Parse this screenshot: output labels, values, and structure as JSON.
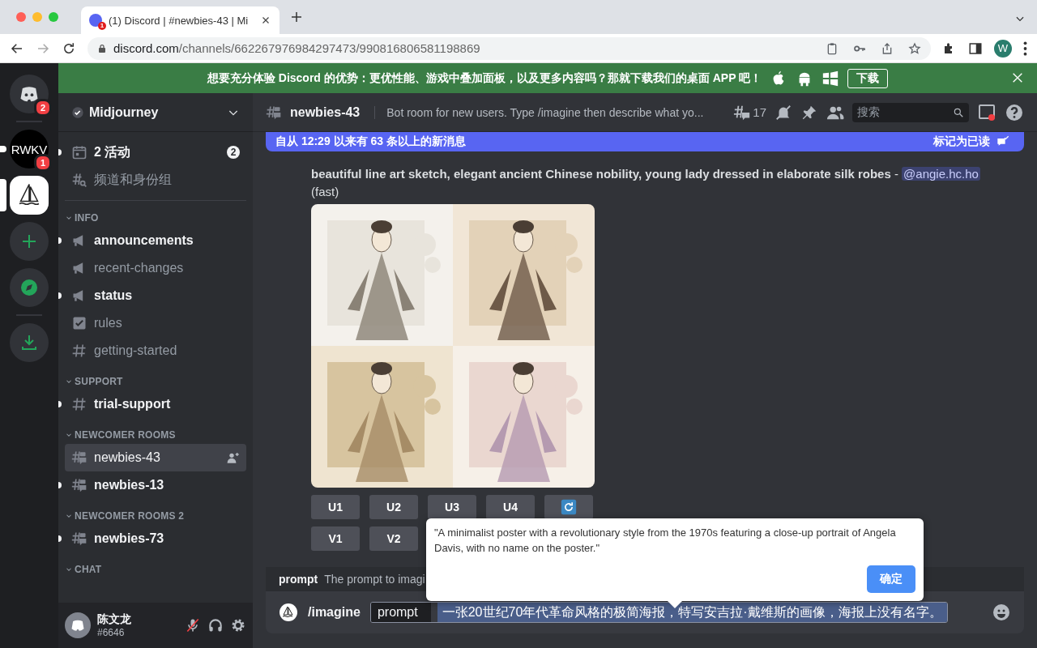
{
  "browser": {
    "tab_title": "(1) Discord | #newbies-43 | Mi",
    "tab_badge": "1",
    "url_domain": "discord.com",
    "url_path": "/channels/662267976984297473/990816806581198869",
    "profile": "W"
  },
  "banner": {
    "text": "想要充分体验 Discord 的优势：更优性能、游戏中叠加面板，以及更多内容吗？那就下载我们的桌面 APP 吧！",
    "button": "下载"
  },
  "servers": [
    {
      "kind": "home",
      "badge": "2",
      "selected": false
    },
    {
      "kind": "text",
      "label": "RWKV",
      "badge": "1",
      "selected": false,
      "unread": true
    },
    {
      "kind": "boat",
      "selected": true
    },
    {
      "kind": "add"
    },
    {
      "kind": "explore"
    },
    {
      "kind": "download"
    }
  ],
  "server_name": "Midjourney",
  "top_items": [
    {
      "kind": "events",
      "label": "2 活动",
      "badge": "2"
    },
    {
      "kind": "browse",
      "label": "频道和身份组"
    }
  ],
  "categories": [
    {
      "name": "INFO",
      "channels": [
        {
          "kind": "announcement",
          "name": "announcements",
          "unread": true,
          "selected": false
        },
        {
          "kind": "announcement",
          "name": "recent-changes",
          "unread": false,
          "selected": false
        },
        {
          "kind": "announcement",
          "name": "status",
          "unread": true,
          "selected": false
        },
        {
          "kind": "rules",
          "name": "rules",
          "unread": false,
          "selected": false
        },
        {
          "kind": "text",
          "name": "getting-started",
          "unread": false,
          "selected": false
        }
      ]
    },
    {
      "name": "SUPPORT",
      "channels": [
        {
          "kind": "text",
          "name": "trial-support",
          "unread": true,
          "selected": false
        }
      ]
    },
    {
      "name": "NEWCOMER ROOMS",
      "channels": [
        {
          "kind": "forum",
          "name": "newbies-43",
          "unread": false,
          "selected": true
        },
        {
          "kind": "forum",
          "name": "newbies-13",
          "unread": true,
          "selected": false
        }
      ]
    },
    {
      "name": "NEWCOMER ROOMS 2",
      "channels": [
        {
          "kind": "forum",
          "name": "newbies-73",
          "unread": true,
          "selected": false
        }
      ]
    },
    {
      "name": "CHAT"
    }
  ],
  "user": {
    "name": "陈文龙",
    "tag": "#6646",
    "muted": true
  },
  "header": {
    "channel": "newbies-43",
    "topic": "Bot room for new users. Type /imagine then describe what yo...",
    "threads": "17",
    "search_placeholder": "搜索"
  },
  "new_messages": {
    "text": "自从 12:29 以来有 63 条以上的新消息",
    "action": "标记为已读"
  },
  "message": {
    "prompt": "beautiful line art sketch, elegant ancient Chinese nobility, young lady dressed in elaborate silk robes",
    "separator": " - ",
    "mention": "@angie.hc.ho",
    "mode": "(fast)",
    "images": [
      {
        "kind": "picture"
      },
      {
        "kind": "picture"
      },
      {
        "kind": "picture"
      },
      {
        "kind": "picture"
      }
    ],
    "button_rows": [
      [
        {
          "kind": "text",
          "label": "U1"
        },
        {
          "kind": "text",
          "label": "U2"
        },
        {
          "kind": "text",
          "label": "U3"
        },
        {
          "kind": "text",
          "label": "U4"
        },
        {
          "kind": "refresh"
        }
      ],
      [
        {
          "kind": "text",
          "label": "V1"
        },
        {
          "kind": "text",
          "label": "V2"
        }
      ]
    ]
  },
  "command_hint": {
    "name": "prompt",
    "text": "The prompt to imagi"
  },
  "composer": {
    "command": "/imagine",
    "option": "prompt",
    "value": "一张20世纪70年代革命风格的极简海报，特写安吉拉·戴维斯的画像，海报上没有名字。"
  },
  "popup": {
    "text": "\"A minimalist poster with a revolutionary style from the 1970s featuring a close-up portrait of Angela Davis, with no name on the poster.\"",
    "button": "确定"
  }
}
